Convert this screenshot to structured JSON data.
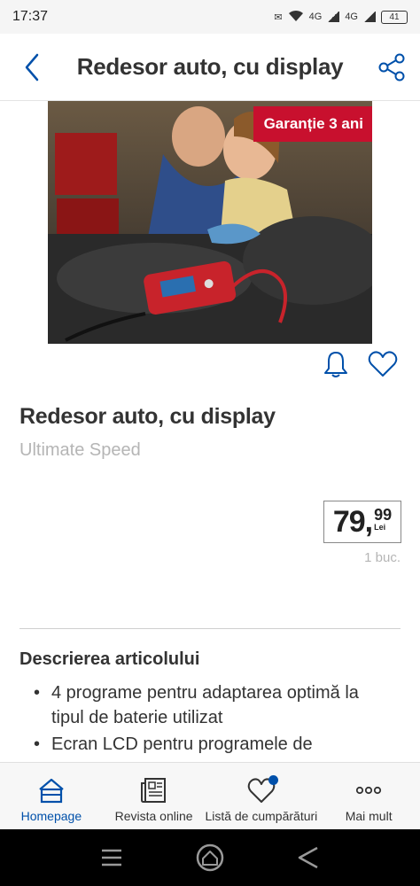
{
  "status_bar": {
    "time": "17:37",
    "network": "4G",
    "network2": "4G",
    "battery": "41"
  },
  "header": {
    "title": "Redesor auto, cu display",
    "back_icon": "chevron-left-icon",
    "share_icon": "share-icon"
  },
  "product": {
    "badge": "Garanție 3 ani",
    "title": "Redesor auto, cu display",
    "brand": "Ultimate Speed",
    "price_main": "79,",
    "price_cents": "99",
    "currency": "Lei",
    "unit": "1 buc."
  },
  "description": {
    "title": "Descrierea articolului",
    "items": [
      "4 programe pentru adaptarea optimă la tipul de baterie utilizat",
      "Ecran LCD pentru programele de"
    ]
  },
  "bottom_nav": {
    "items": [
      {
        "label": "Homepage",
        "icon": "home-icon",
        "active": true
      },
      {
        "label": "Revista online",
        "icon": "magazine-icon"
      },
      {
        "label": "Listă de cumpărături",
        "icon": "heart-icon"
      },
      {
        "label": "Mai mult",
        "icon": "more-icon"
      }
    ]
  },
  "colors": {
    "accent": "#0050aa",
    "badge": "#c8102e"
  }
}
